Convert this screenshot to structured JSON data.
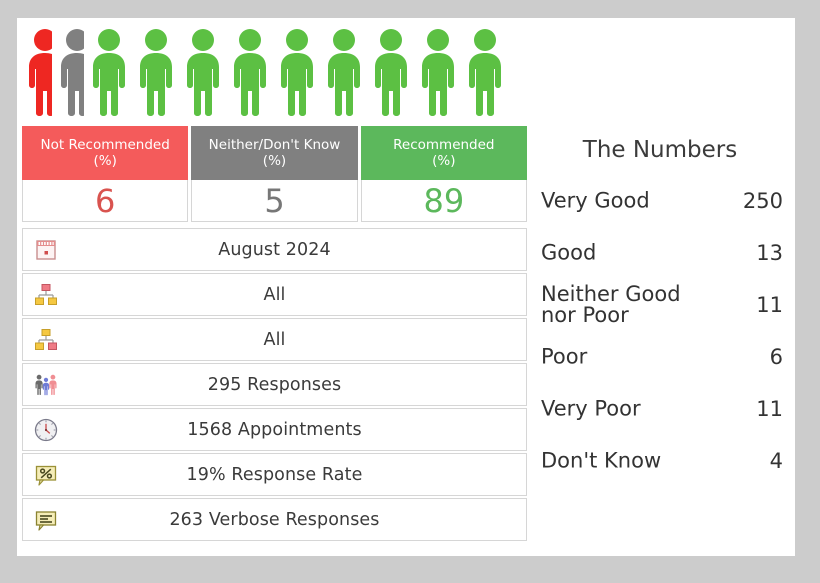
{
  "colors": {
    "background": "#cccccc",
    "panel": "#ffffff",
    "not_recommended": "#f45b5b",
    "neither": "#808080",
    "recommended": "#5cb85c",
    "not_recommended_text": "#d9534f",
    "neither_text": "#777777",
    "recommended_text": "#5cb85c",
    "border": "#d6d6d6",
    "text": "#3b3b3b"
  },
  "pictogram": {
    "name": "people-pictogram",
    "total": 11,
    "figures": [
      {
        "color": "#ee2722",
        "category": "not-recommended",
        "clipped": true
      },
      {
        "color": "#808080",
        "category": "neither",
        "clipped": true
      },
      {
        "color": "#5cc043",
        "category": "recommended",
        "clipped": false
      },
      {
        "color": "#5cc043",
        "category": "recommended",
        "clipped": false
      },
      {
        "color": "#5cc043",
        "category": "recommended",
        "clipped": false
      },
      {
        "color": "#5cc043",
        "category": "recommended",
        "clipped": false
      },
      {
        "color": "#5cc043",
        "category": "recommended",
        "clipped": false
      },
      {
        "color": "#5cc043",
        "category": "recommended",
        "clipped": false
      },
      {
        "color": "#5cc043",
        "category": "recommended",
        "clipped": false
      },
      {
        "color": "#5cc043",
        "category": "recommended",
        "clipped": false
      },
      {
        "color": "#5cc043",
        "category": "recommended",
        "clipped": false
      }
    ]
  },
  "summary": {
    "cells": [
      {
        "header_line1": "Not Recommended",
        "header_line2": "(%)",
        "value": "6",
        "bg": "#f45b5b",
        "value_color": "#d9534f"
      },
      {
        "header_line1": "Neither/Don't Know",
        "header_line2": "(%)",
        "value": "5",
        "bg": "#808080",
        "value_color": "#777777"
      },
      {
        "header_line1": "Recommended",
        "header_line2": "(%)",
        "value": "89",
        "bg": "#5cb85c",
        "value_color": "#5cb85c"
      }
    ]
  },
  "info_rows": [
    {
      "icon": "calendar-icon",
      "text": "August 2024"
    },
    {
      "icon": "org-chart-red-top-icon",
      "text": "All"
    },
    {
      "icon": "org-chart-yellow-top-icon",
      "text": "All"
    },
    {
      "icon": "people-group-icon",
      "text": "295 Responses"
    },
    {
      "icon": "clock-icon",
      "text": "1568 Appointments"
    },
    {
      "icon": "percent-note-icon",
      "text": "19% Response Rate"
    },
    {
      "icon": "comment-icon",
      "text": "263 Verbose Responses"
    }
  ],
  "numbers_panel": {
    "title": "The Numbers",
    "rows": [
      {
        "label": "Very Good",
        "value": "250"
      },
      {
        "label": "Good",
        "value": "13"
      },
      {
        "label": "Neither Good\nnor Poor",
        "value": "11"
      },
      {
        "label": "Poor",
        "value": "6"
      },
      {
        "label": "Very Poor",
        "value": "11"
      },
      {
        "label": "Don't Know",
        "value": "4"
      }
    ]
  }
}
